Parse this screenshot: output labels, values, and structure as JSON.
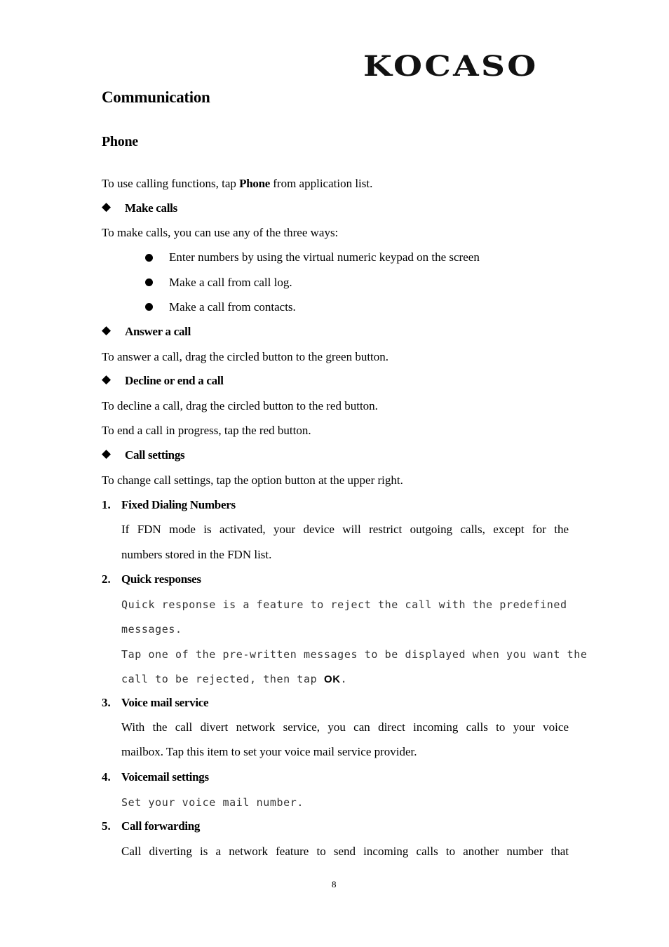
{
  "header": {
    "logo": "KOCASO"
  },
  "title": "Communication",
  "section": "Phone",
  "intro": {
    "before": "To use calling functions, tap ",
    "bold": "Phone",
    "after": " from application list."
  },
  "make_calls": {
    "heading": "Make calls",
    "text": "To make calls, you can use any of the three ways:",
    "bullets": [
      "Enter numbers by using the virtual numeric keypad on the screen",
      "Make a call from call log.",
      "Make a call from contacts."
    ]
  },
  "answer_call": {
    "heading": "Answer a call",
    "text": "To answer a call, drag the circled button to the green button."
  },
  "decline_call": {
    "heading": "Decline or end a call",
    "text1": "To decline a call, drag the circled button to the red button.",
    "text2": "To end a call in progress, tap the red button."
  },
  "call_settings": {
    "heading": "Call settings",
    "text": "To change call settings, tap the option button at the upper right.",
    "items": [
      {
        "num": "1.",
        "label": "Fixed Dialing Numbers",
        "lines": [
          "If FDN mode is activated, your device will restrict outgoing calls, except for the",
          "numbers stored in the FDN list."
        ]
      },
      {
        "num": "2.",
        "label": "Quick responses",
        "lines": [
          "Quick response is a feature to reject the call with the predefined",
          "messages.",
          "Tap one of the pre-written messages to be displayed when you want the"
        ],
        "last_before": "call to be rejected, then tap ",
        "last_bold": "OK",
        "last_after": "."
      },
      {
        "num": "3.",
        "label": "Voice mail service",
        "lines": [
          "With the call divert network service, you can direct incoming calls to your voice",
          "mailbox. Tap this item to set your voice mail service provider."
        ]
      },
      {
        "num": "4.",
        "label": "Voicemail settings",
        "lines": [
          "Set your voice mail number."
        ]
      },
      {
        "num": "5.",
        "label": "Call forwarding",
        "lines": [
          "Call diverting is a network feature to send incoming calls to another number that"
        ]
      }
    ]
  },
  "page_number": "8"
}
